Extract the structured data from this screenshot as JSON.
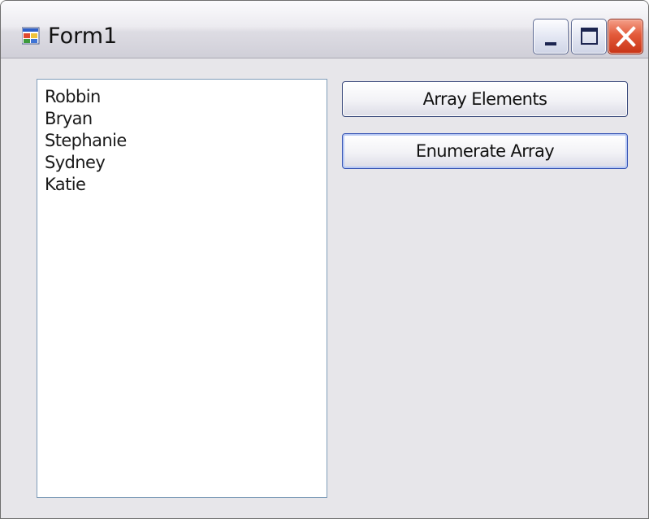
{
  "window": {
    "title": "Form1",
    "icon": "form-app-icon",
    "controls": [
      "minimize-icon",
      "maximize-icon",
      "close-icon"
    ]
  },
  "listbox": {
    "items": [
      "Robbin",
      "Bryan",
      "Stephanie",
      "Sydney",
      "Katie"
    ]
  },
  "buttons": {
    "array_elements": "Array Elements",
    "enumerate_array": "Enumerate Array"
  },
  "colors": {
    "close_button": "#d9472a",
    "window_background": "#e7e6ea",
    "focus_border": "#3a57b5"
  }
}
